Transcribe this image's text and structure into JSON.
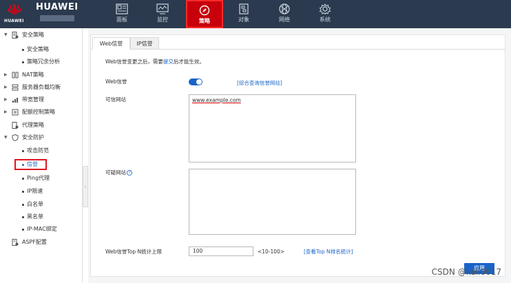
{
  "brand": {
    "name": "HUAWEI",
    "logo_text": "HUAWEI"
  },
  "nav": [
    {
      "label": "面板",
      "icon": "dashboard-icon",
      "active": false
    },
    {
      "label": "监控",
      "icon": "monitor-chart-icon",
      "active": false
    },
    {
      "label": "策略",
      "icon": "compass-icon",
      "active": true
    },
    {
      "label": "对象",
      "icon": "object-icon",
      "active": false
    },
    {
      "label": "网络",
      "icon": "network-globe-icon",
      "active": false
    },
    {
      "label": "系统",
      "icon": "gear-icon",
      "active": false
    }
  ],
  "sidebar": {
    "items": [
      {
        "label": "安全策略",
        "expanded": true
      },
      {
        "label": "安全策略"
      },
      {
        "label": "策略冗余分析"
      },
      {
        "label": "NAT策略"
      },
      {
        "label": "服务器负载均衡"
      },
      {
        "label": "带宽管理"
      },
      {
        "label": "配额控制策略"
      },
      {
        "label": "代理策略"
      },
      {
        "label": "安全防护"
      },
      {
        "label": "攻击防范"
      },
      {
        "label": "信誉"
      },
      {
        "label": "Ping代理"
      },
      {
        "label": "IP限速"
      },
      {
        "label": "白名单"
      },
      {
        "label": "黑名单"
      },
      {
        "label": "IP-MAC绑定"
      },
      {
        "label": "ASPF配置"
      }
    ]
  },
  "tabs": [
    {
      "label": "Web信誉",
      "active": true
    },
    {
      "label": "IP信誉",
      "active": false
    }
  ],
  "info": {
    "prefix": "Web信誉变更之后，需要",
    "link": "提交",
    "suffix": "后才能生效。"
  },
  "form": {
    "web_reputation_label": "Web信誉",
    "web_reputation_enabled": true,
    "query_link": "[综合查询信誉网站]",
    "trusted_label": "可信网站",
    "trusted_value": "www.example.com",
    "suspicious_label": "可疑网站",
    "suspicious_value": "",
    "topn_label": "Web信誉Top N统计上限",
    "topn_value": "100",
    "topn_range": "<10-100>",
    "topn_link": "[查看Top N排名统计]",
    "apply_label": "应用"
  },
  "watermark": "CSDN @kali0617",
  "colors": {
    "topbar": "#2b3a4e",
    "active_nav": "#c7000b",
    "primary": "#1a64c8",
    "highlight_border": "#e0141e"
  }
}
